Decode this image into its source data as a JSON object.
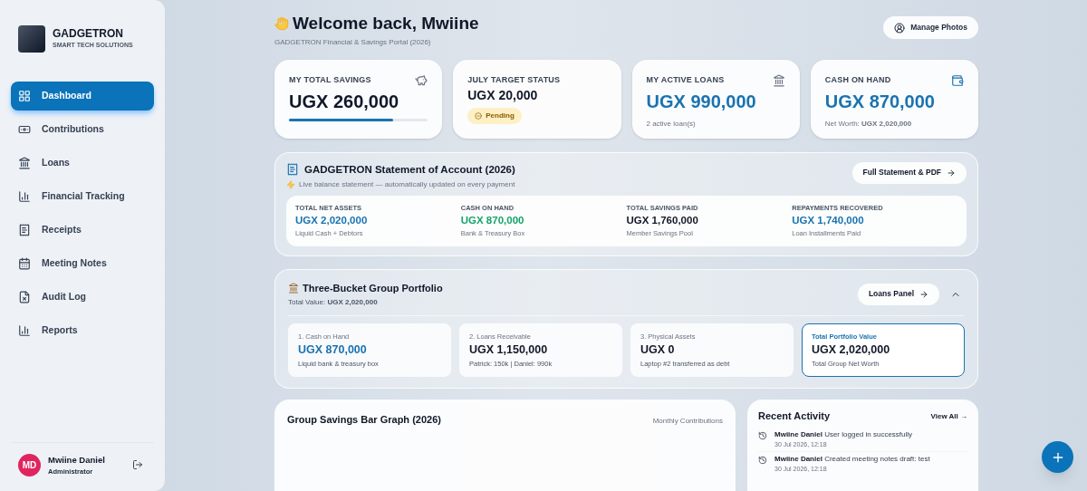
{
  "brand": {
    "name": "GADGETRON",
    "tagline": "SMART TECH SOLUTIONS"
  },
  "nav": [
    {
      "label": "Dashboard",
      "selected": true
    },
    {
      "label": "Contributions",
      "selected": false
    },
    {
      "label": "Loans",
      "selected": false
    },
    {
      "label": "Financial Tracking",
      "selected": false
    },
    {
      "label": "Receipts",
      "selected": false
    },
    {
      "label": "Meeting Notes",
      "selected": false
    },
    {
      "label": "Audit Log",
      "selected": false
    },
    {
      "label": "Reports",
      "selected": false
    }
  ],
  "user": {
    "initials": "MD",
    "name": "Mwiine Daniel",
    "role": "Administrator"
  },
  "header": {
    "title": "Welcome back, Mwiine",
    "subtitle": "GADGETRON Financial & Savings Portal (2026)",
    "action": "Manage Photos"
  },
  "stats": [
    {
      "kind": "progress",
      "label": "MY TOTAL SAVINGS",
      "value": "UGX 260,000",
      "level": 0.75
    },
    {
      "kind": "badge",
      "label": "JULY TARGET STATUS",
      "value": "UGX 20,000",
      "badge": "Pending"
    },
    {
      "kind": "note",
      "label": "MY ACTIVE LOANS",
      "value": "UGX 990,000",
      "note": "2 active loan(s)"
    },
    {
      "kind": "note",
      "label": "CASH ON HAND",
      "value": "UGX 870,000",
      "note": "Net Worth: **UGX 2,020,000**"
    }
  ],
  "statement": {
    "title": "GADGETRON Statement of Account (2026)",
    "subtitle": "Live balance statement — automatically updated on every payment",
    "action": "Full Statement & PDF",
    "items": [
      {
        "label": "TOTAL NET ASSETS",
        "value": "UGX 2,020,000",
        "note": "Liquid Cash + Debtors",
        "color": "#1a73b0"
      },
      {
        "label": "CASH ON HAND",
        "value": "UGX 870,000",
        "note": "Bank & Treasury Box",
        "color": "#16a36a"
      },
      {
        "label": "TOTAL SAVINGS PAID",
        "value": "UGX 1,760,000",
        "note": "Member Savings Pool",
        "color": "#111827"
      },
      {
        "label": "REPAYMENTS RECOVERED",
        "value": "UGX 1,740,000",
        "note": "Loan Installments Paid",
        "color": "#1a73b0"
      }
    ]
  },
  "portfolio": {
    "title": "Three-Bucket Group Portfolio",
    "total": "Total Value: **UGX 2,020,000**",
    "action": "Loans Panel",
    "expanded": true,
    "buckets": [
      {
        "label": "1. Cash on Hand",
        "value": "UGX 870,000",
        "note": "Liquid bank & treasury box",
        "selected": false,
        "color": "#1a73b0"
      },
      {
        "label": "2. Loans Receivable",
        "value": "UGX 1,150,000",
        "note": "Patrick: 150k | Daniel: 990k",
        "selected": false,
        "color": "#111827"
      },
      {
        "label": "3. Physical Assets",
        "value": "UGX 0",
        "note": "Laptop #2 transferred as debt",
        "selected": false,
        "color": "#111827"
      },
      {
        "label": "Total Portfolio Value",
        "value": "UGX 2,020,000",
        "note": "Total Group Net Worth",
        "selected": true,
        "color": "#111827"
      }
    ]
  },
  "chart_card": {
    "title": "Group Savings Bar Graph (2026)",
    "caption": "Monthly Contributions"
  },
  "activity": {
    "title": "Recent Activity",
    "action": "View All →",
    "items": [
      {
        "user": "Mwiine Daniel",
        "text": "User logged in successfully",
        "time": "30 Jul 2026, 12:18"
      },
      {
        "user": "Mwiine Daniel",
        "text": "Created meeting notes draft: test",
        "time": "30 Jul 2026, 12:18"
      }
    ]
  }
}
